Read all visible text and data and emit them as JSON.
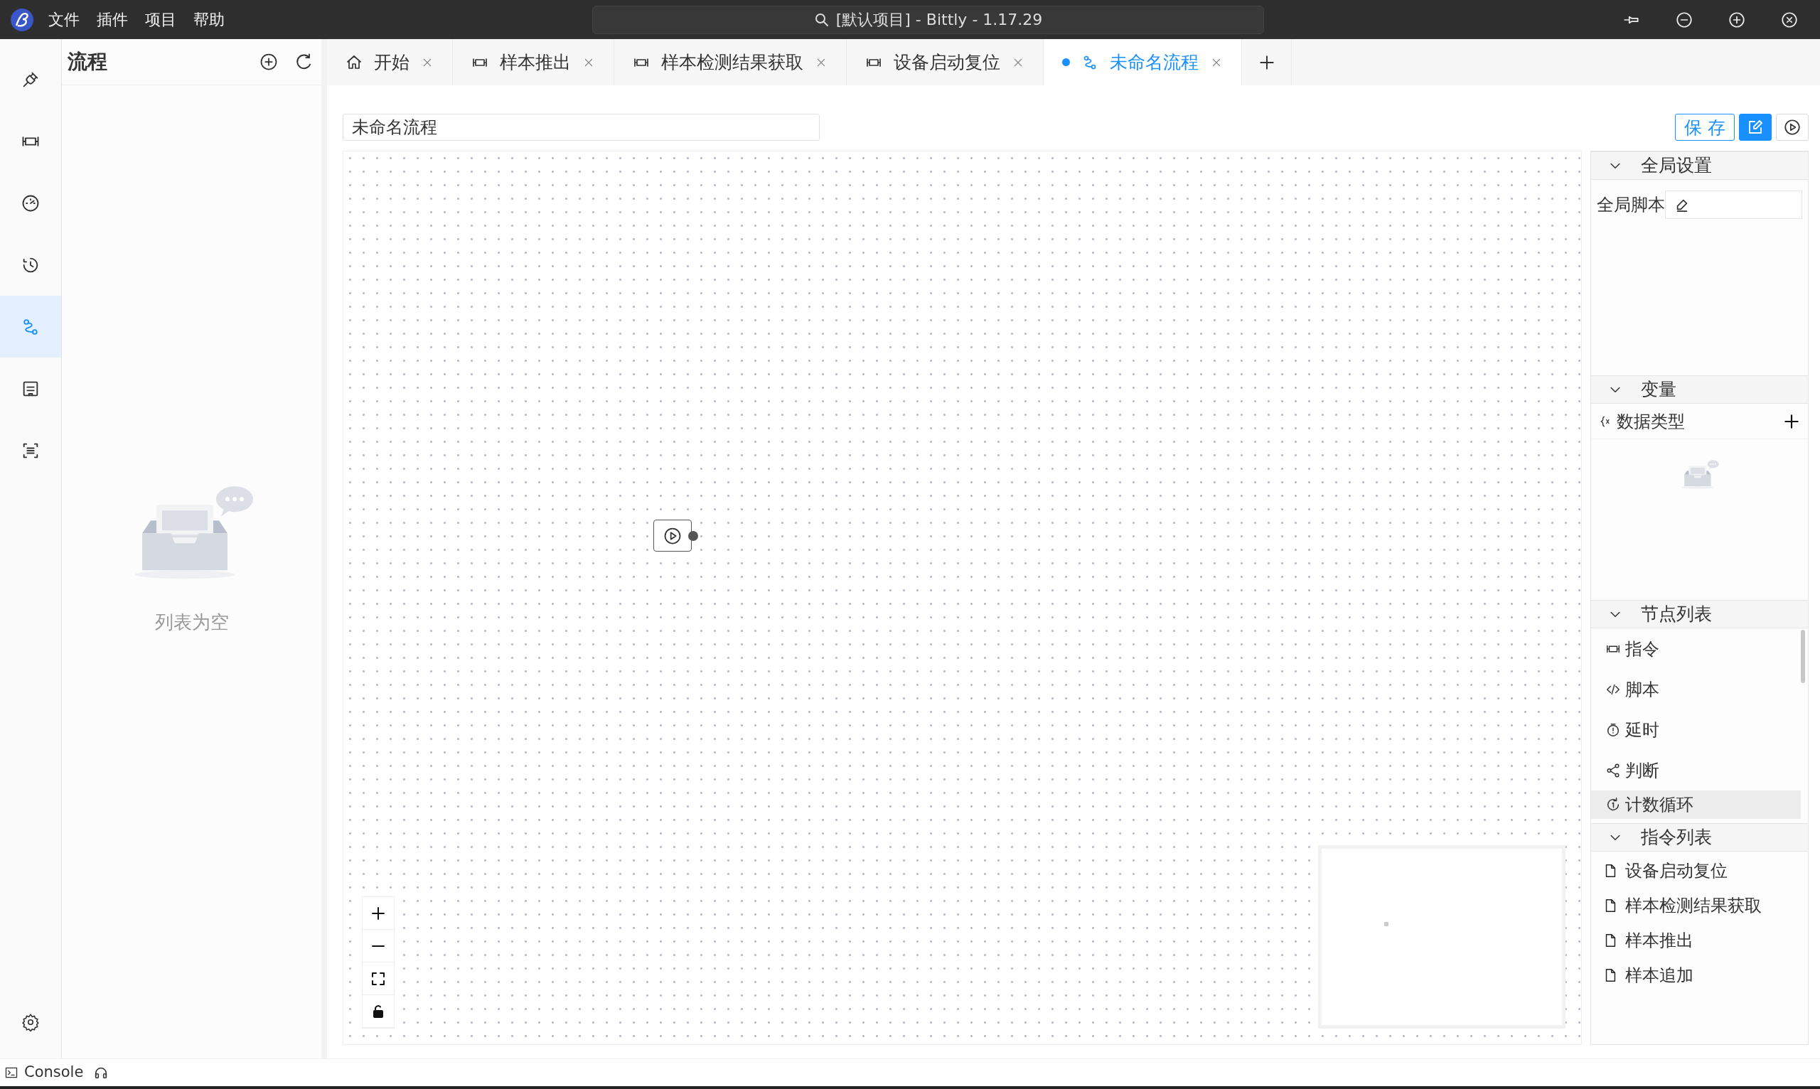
{
  "title_bar": {
    "menu": [
      "文件",
      "插件",
      "项目",
      "帮助"
    ],
    "search_text": "[默认项目] - Bittly - 1.17.29"
  },
  "activity_bar": [
    {
      "kind": "plug",
      "selected": false
    },
    {
      "kind": "command",
      "selected": false
    },
    {
      "kind": "gauge",
      "selected": false
    },
    {
      "kind": "history",
      "selected": false
    },
    {
      "kind": "flow",
      "selected": true
    },
    {
      "kind": "board",
      "selected": false
    },
    {
      "kind": "scan",
      "selected": false
    }
  ],
  "left_panel": {
    "title": "流程",
    "empty_text": "列表为空"
  },
  "tabs": [
    {
      "label": "开始",
      "kind": "home",
      "selected": false,
      "modified": false
    },
    {
      "label": "样本推出",
      "kind": "command",
      "selected": false,
      "modified": false
    },
    {
      "label": "样本检测结果获取",
      "kind": "command",
      "selected": false,
      "modified": false
    },
    {
      "label": "设备启动复位",
      "kind": "command",
      "selected": false,
      "modified": false
    },
    {
      "label": "未命名流程",
      "kind": "flow",
      "selected": true,
      "modified": true
    }
  ],
  "editor": {
    "flow_name": "未命名流程",
    "save_label": "保 存",
    "edit_mode": true
  },
  "right_panel": {
    "sections": [
      {
        "kind": "globals",
        "title": "全局设置",
        "expanded": true,
        "script_label": "全局脚本"
      },
      {
        "kind": "variables",
        "title": "变量",
        "expanded": true,
        "column": "数据类型"
      },
      {
        "kind": "nodes",
        "title": "节点列表",
        "expanded": true,
        "items": [
          {
            "label": "指令",
            "kind": "command",
            "highlighted": false
          },
          {
            "label": "脚本",
            "kind": "code",
            "highlighted": false
          },
          {
            "label": "延时",
            "kind": "timer",
            "highlighted": false
          },
          {
            "label": "判断",
            "kind": "branch",
            "highlighted": false
          },
          {
            "label": "计数循环",
            "kind": "loop",
            "highlighted": true
          }
        ]
      },
      {
        "kind": "commands",
        "title": "指令列表",
        "expanded": true,
        "items": [
          "设备启动复位",
          "样本检测结果获取",
          "样本推出",
          "样本追加"
        ]
      }
    ]
  },
  "status_bar": {
    "console": "Console"
  }
}
